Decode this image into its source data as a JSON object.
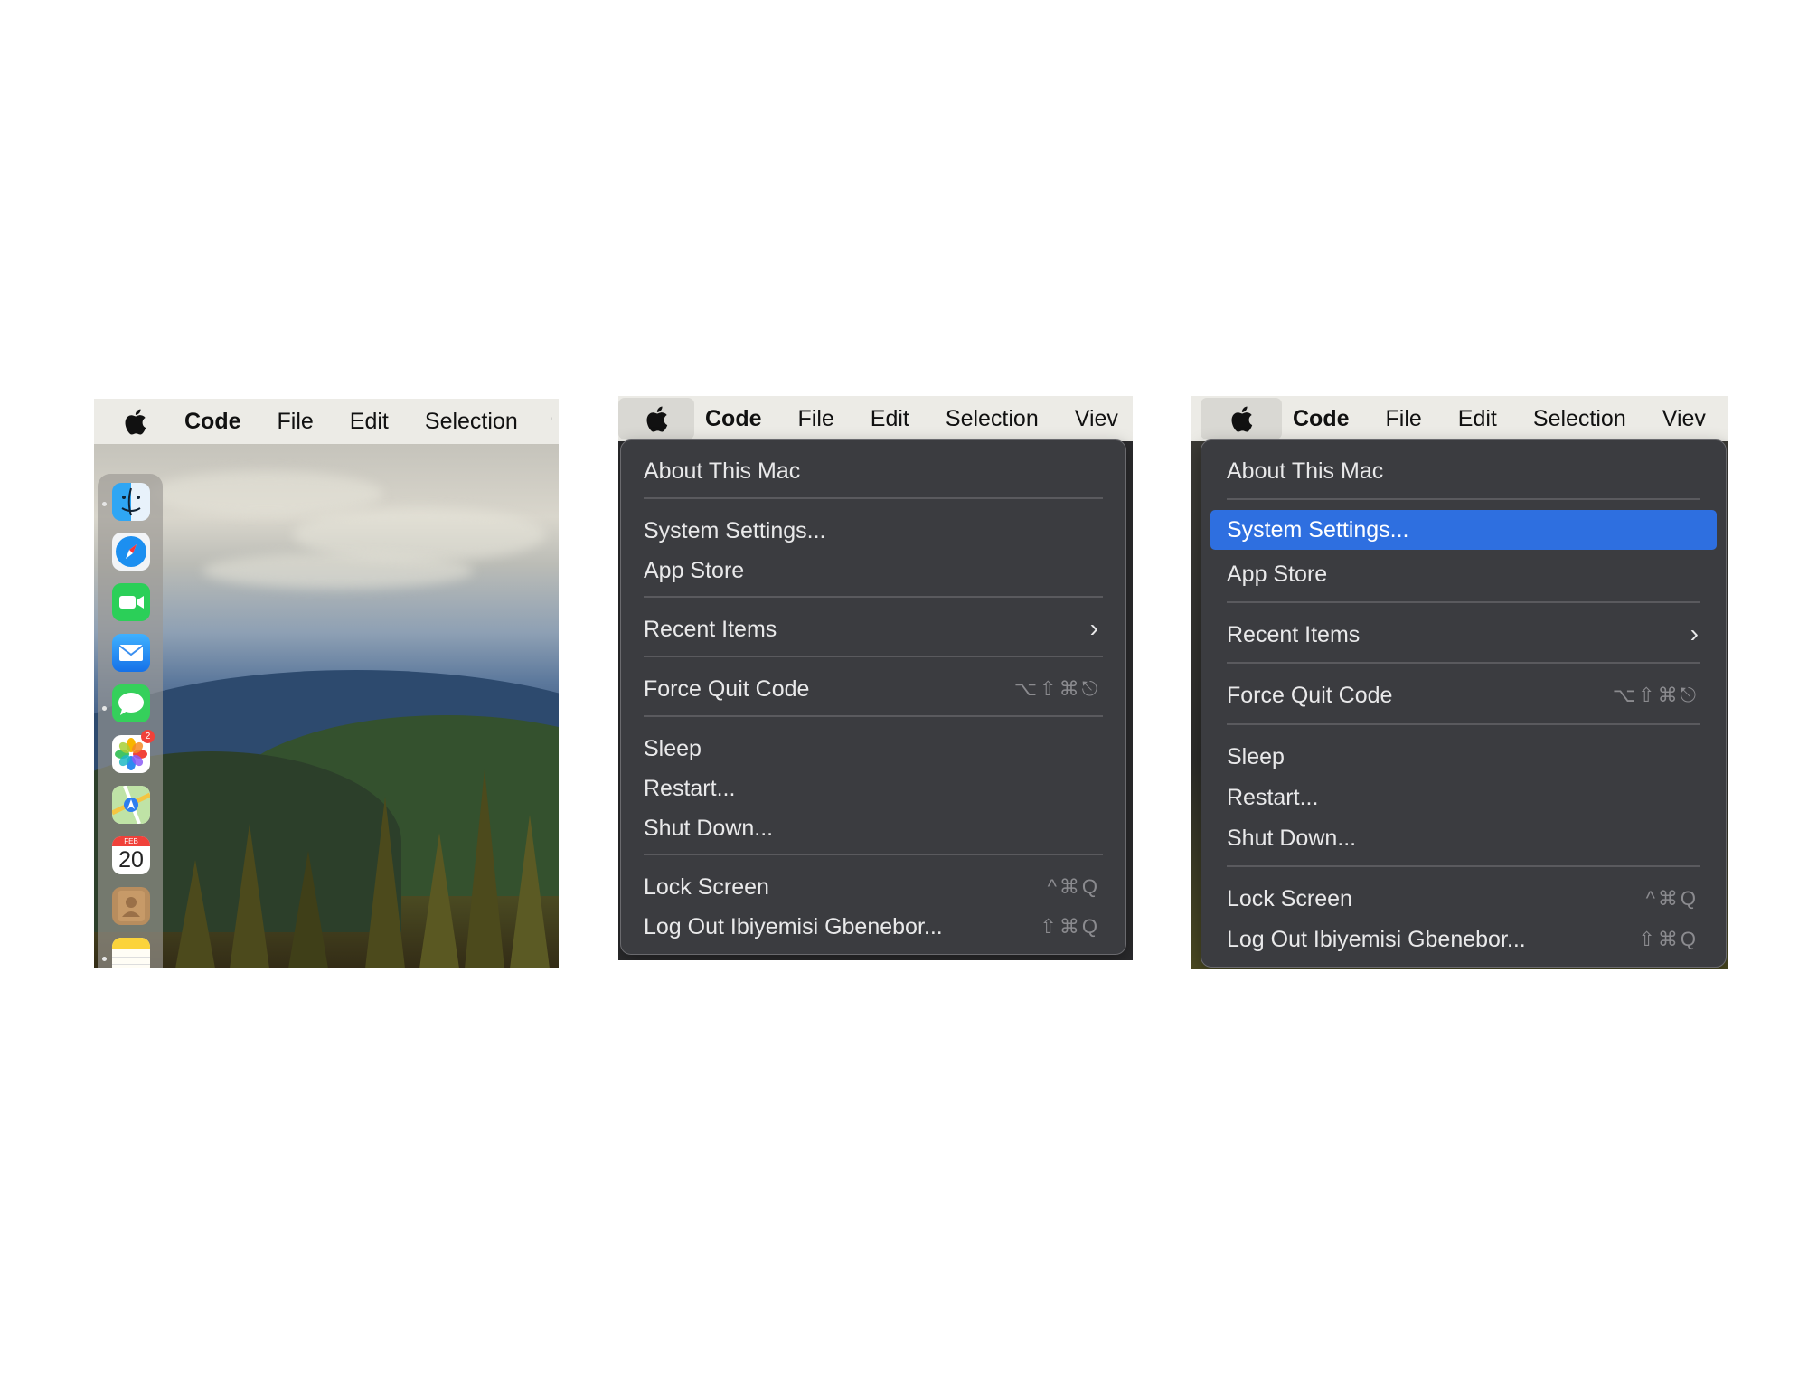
{
  "screens": [
    {
      "menubar": {
        "apple_icon": "apple-logo-icon",
        "items": [
          "Code",
          "File",
          "Edit",
          "Selection",
          "V"
        ]
      },
      "dock": {
        "apps": [
          "finder-icon",
          "safari-icon",
          "facetime-icon",
          "mail-icon",
          "messages-icon",
          "photos-icon",
          "maps-icon",
          "calendar-icon",
          "contacts-icon",
          "notes-icon"
        ],
        "photos_badge": "2",
        "calendar_month": "FEB",
        "calendar_day": "20"
      }
    },
    {
      "menubar": {
        "apple_icon": "apple-logo-icon",
        "items": [
          "Code",
          "File",
          "Edit",
          "Selection",
          "Viev"
        ]
      },
      "menu": {
        "items": [
          {
            "label": "About This Mac"
          },
          {
            "label": "System Settings..."
          },
          {
            "label": "App Store"
          },
          {
            "label": "Recent Items",
            "submenu_icon": "chevron-right-icon"
          },
          {
            "label": "Force Quit Code",
            "shortcut": "⌥⇧⌘⎋"
          },
          {
            "label": "Sleep"
          },
          {
            "label": "Restart..."
          },
          {
            "label": "Shut Down..."
          },
          {
            "label": "Lock Screen",
            "shortcut": "^⌘Q"
          },
          {
            "label": "Log Out Ibiyemisi Gbenebor...",
            "shortcut": "⇧⌘Q"
          }
        ]
      }
    },
    {
      "menubar": {
        "apple_icon": "apple-logo-icon",
        "items": [
          "Code",
          "File",
          "Edit",
          "Selection",
          "Viev"
        ]
      },
      "menu": {
        "highlighted_item": "System Settings...",
        "highlight_color": "#2e6fe0",
        "items": [
          {
            "label": "About This Mac"
          },
          {
            "label": "System Settings..."
          },
          {
            "label": "App Store"
          },
          {
            "label": "Recent Items",
            "submenu_icon": "chevron-right-icon"
          },
          {
            "label": "Force Quit Code",
            "shortcut": "⌥⇧⌘⎋"
          },
          {
            "label": "Sleep"
          },
          {
            "label": "Restart..."
          },
          {
            "label": "Shut Down..."
          },
          {
            "label": "Lock Screen",
            "shortcut": "^⌘Q"
          },
          {
            "label": "Log Out Ibiyemisi Gbenebor...",
            "shortcut": "⇧⌘Q"
          }
        ]
      }
    }
  ]
}
